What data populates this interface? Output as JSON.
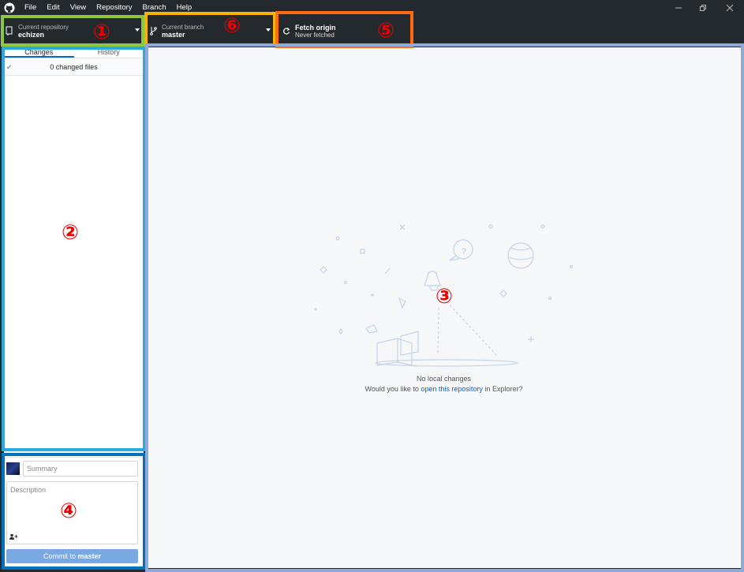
{
  "titlebar": {
    "menu": [
      "File",
      "Edit",
      "View",
      "Repository",
      "Branch",
      "Help"
    ]
  },
  "toolbar": {
    "repo": {
      "label": "Current repository",
      "value": "echizen"
    },
    "branch": {
      "label": "Current branch",
      "value": "master"
    },
    "fetch": {
      "label": "Fetch origin",
      "sub": "Never fetched"
    }
  },
  "annotations": {
    "n1": "①",
    "n2": "②",
    "n3": "③",
    "n4": "④",
    "n5": "⑤",
    "n6": "⑥"
  },
  "sidebar": {
    "tabs": [
      "Changes",
      "History"
    ],
    "changes_summary": "0 changed files"
  },
  "commit": {
    "summary_placeholder": "Summary",
    "description_placeholder": "Description",
    "button_prefix": "Commit to ",
    "button_branch": "master"
  },
  "main": {
    "no_changes": "No local changes",
    "prompt_before": "Would you like to ",
    "prompt_link": "open this repository",
    "prompt_after": " in Explorer?"
  },
  "colors": {
    "box1": "#8dc63f",
    "box2": "#29abe2",
    "box3": "#8eaadb",
    "box4": "#0071bc",
    "box5": "#ff6a13",
    "box6": "#f7b500"
  }
}
